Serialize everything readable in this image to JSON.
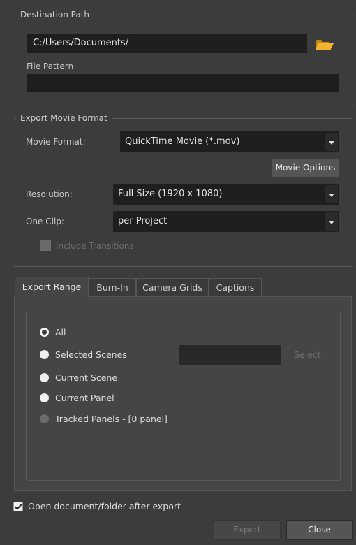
{
  "destination": {
    "group_title": "Destination Path",
    "path_value": "C:/Users/Documents/",
    "file_pattern_label": "File Pattern",
    "file_pattern_value": ""
  },
  "export_format": {
    "group_title": "Export Movie Format",
    "movie_format_label": "Movie Format:",
    "movie_format_value": "QuickTime Movie (*.mov)",
    "movie_options_button": "Movie Options",
    "resolution_label": "Resolution:",
    "resolution_value": "Full Size (1920 x 1080)",
    "one_clip_label": "One Clip:",
    "one_clip_value": "per Project",
    "include_transitions_label": "Include Transitions"
  },
  "tabs": [
    {
      "label": "Export Range"
    },
    {
      "label": "Burn-In"
    },
    {
      "label": "Camera Grids"
    },
    {
      "label": "Captions"
    }
  ],
  "range": {
    "all_label": "All",
    "selected_scenes_label": "Selected Scenes",
    "selected_scenes_value": "",
    "select_button": "Select",
    "current_scene_label": "Current Scene",
    "current_panel_label": "Current Panel",
    "tracked_panels_label": "Tracked Panels - [0 panel]"
  },
  "footer": {
    "open_after_export_label": "Open document/folder after export",
    "export_button": "Export",
    "close_button": "Close"
  }
}
